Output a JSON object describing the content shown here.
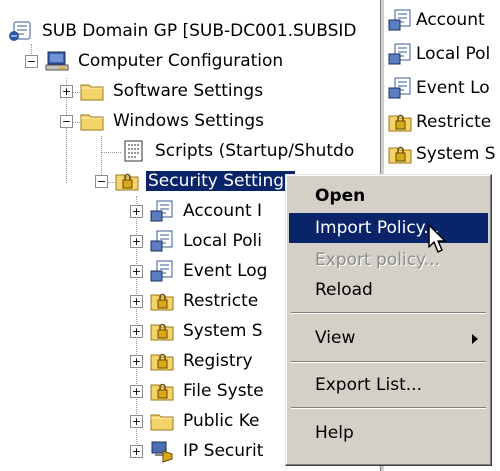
{
  "tree": {
    "items": [
      {
        "label": "SUB Domain GP [SUB-DC001.SUBSID",
        "icon": "gpo-scroll-icon"
      },
      {
        "label": "Computer Configuration",
        "icon": "computer-icon"
      },
      {
        "label": "Software Settings",
        "icon": "folder-icon"
      },
      {
        "label": "Windows Settings",
        "icon": "folder-icon"
      },
      {
        "label": "Scripts (Startup/Shutdo",
        "icon": "script-icon"
      },
      {
        "label": "Security Settings",
        "icon": "security-folder-icon"
      },
      {
        "label": "Account I",
        "icon": "policy-icon"
      },
      {
        "label": "Local Poli",
        "icon": "policy-icon"
      },
      {
        "label": "Event Log",
        "icon": "policy-icon"
      },
      {
        "label": "Restricte",
        "icon": "locked-folder-icon"
      },
      {
        "label": "System S",
        "icon": "locked-folder-icon"
      },
      {
        "label": "Registry",
        "icon": "locked-folder-icon"
      },
      {
        "label": "File Syste",
        "icon": "locked-folder-icon"
      },
      {
        "label": "Public Ke",
        "icon": "folder-icon"
      },
      {
        "label": "IP Securit",
        "icon": "ip-security-icon"
      }
    ],
    "expanders": {
      "minus": "−",
      "plus": "+"
    }
  },
  "right_pane": {
    "items": [
      {
        "label": "Account",
        "icon": "policy-icon"
      },
      {
        "label": "Local Pol",
        "icon": "policy-icon"
      },
      {
        "label": "Event Lo",
        "icon": "policy-icon"
      },
      {
        "label": "Restricte",
        "icon": "locked-folder-icon"
      },
      {
        "label": "System S",
        "icon": "locked-folder-icon"
      }
    ]
  },
  "context_menu": {
    "open": "Open",
    "import_policy": "Import Policy...",
    "export_policy": "Export policy...",
    "reload": "Reload",
    "view": "View",
    "export_list": "Export List...",
    "help": "Help"
  },
  "colors": {
    "selection": "#0a246a",
    "menu_bg": "#d4d0c8",
    "folder": "#f4d46a"
  }
}
